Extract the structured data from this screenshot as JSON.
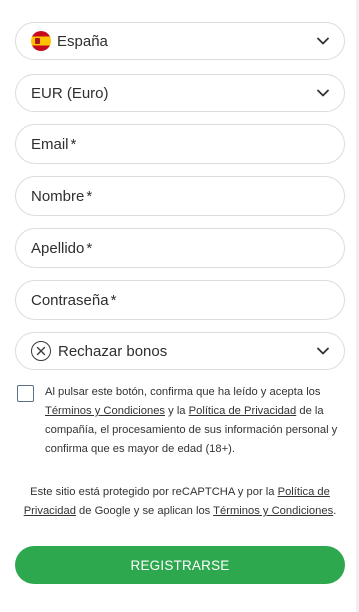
{
  "country": {
    "value": "España",
    "icon": "spain-flag-icon"
  },
  "currency": {
    "value": "EUR (Euro)"
  },
  "fields": {
    "email": "Email",
    "nombre": "Nombre",
    "apellido": "Apellido",
    "password": "Contraseña",
    "required_marker": "*"
  },
  "bonus": {
    "value": "Rechazar bonos",
    "icon": "close-circle-icon"
  },
  "consent": {
    "part1": "Al pulsar este botón, confirma que ha leído y acepta los ",
    "terms_link": "Términos y Condiciones",
    "part2": " y la ",
    "privacy_link": "Política de Privacidad",
    "part3": " de la compañía, el procesamiento de sus información personal y confirma que es mayor de edad (18+)."
  },
  "captcha": {
    "part1": "Este sitio está protegido por reCAPTCHA y por la ",
    "privacy_link": "Política de Privacidad",
    "part2": " de Google y se aplican los ",
    "terms_link": "Términos y Condiciones",
    "part3": "."
  },
  "register_label": "REGISTRARSE",
  "colors": {
    "accent": "#2ea84f",
    "border": "#dcdcdc"
  }
}
